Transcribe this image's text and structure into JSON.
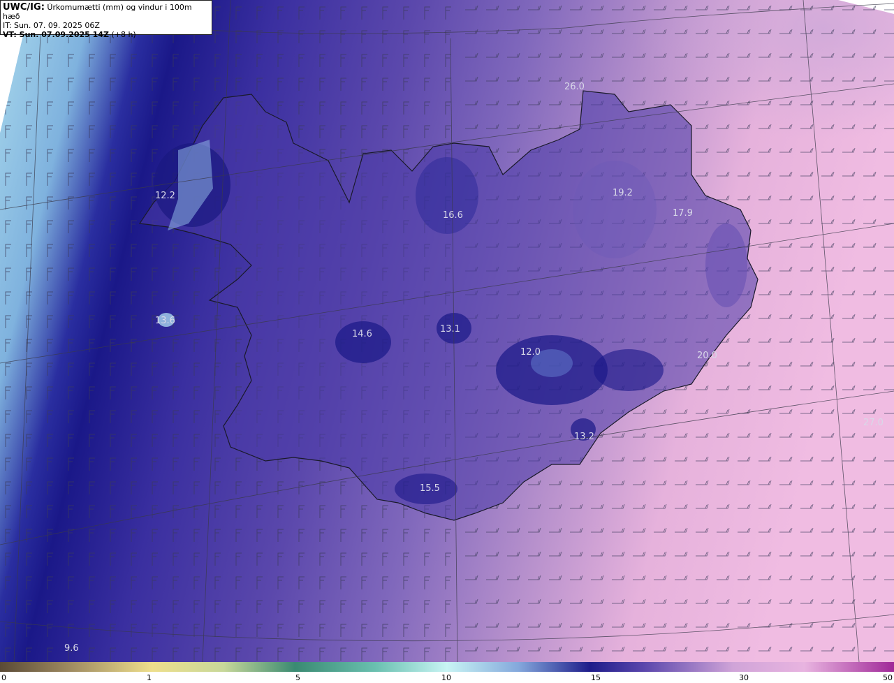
{
  "header": {
    "model": "UWC/IG:",
    "description": "Úrkomumætti (mm) og vindur i 100m hæð",
    "issue_time": "IT: Sun. 07. 09. 2025 06Z",
    "valid_time_bold": "VT: Sun. 07.09.2025 14Z",
    "valid_time_offset": "(+8 h)"
  },
  "map_labels": [
    "26.0",
    "12.2",
    "16.6",
    "19.2",
    "17.9",
    "13.6",
    "14.6",
    "13.1",
    "12.0",
    "20.0",
    "13.2",
    "15.5",
    "27.0",
    "9.6"
  ],
  "colorbar": {
    "ticks": [
      "0",
      "1",
      "5",
      "10",
      "15",
      "30",
      "50"
    ],
    "colors": [
      "#6b5a3e",
      "#c8b27a",
      "#f0e68c",
      "#3a9a7a",
      "#bfeff0",
      "#8fb4e0",
      "#1f1f8c",
      "#7a5bb0",
      "#e0a8d8",
      "#b030a0"
    ]
  },
  "palette": {
    "west_light": "#9ec8e6",
    "dark_band": "#1c1a8e",
    "mid_purple": "#6a52b2",
    "east_pink": "#e8b0dc"
  }
}
